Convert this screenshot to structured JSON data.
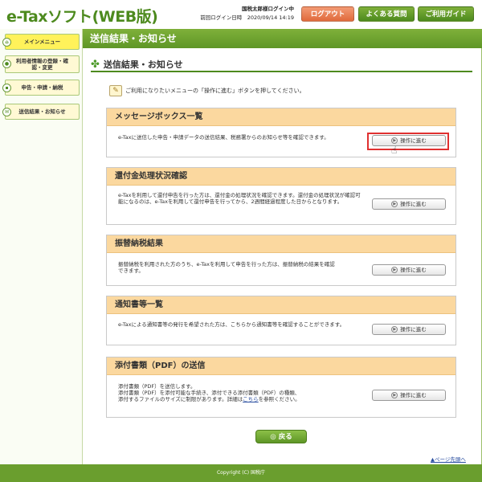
{
  "header": {
    "logo_main": "e-Taxソフト",
    "logo_paren": "(WEB版)",
    "user_status": "国税太郎様ログイン中",
    "last_login": "前回ログイン日時　2020/09/14 14:19",
    "logout": "ログアウト",
    "faq": "よくある質問",
    "guide": "ご利用ガイド"
  },
  "sidebar": {
    "items": [
      {
        "label": "メインメニュー"
      },
      {
        "label": "利用者情報の登録・確認・変更"
      },
      {
        "label": "申告・申請・納税"
      },
      {
        "label": "送信結果・お知らせ"
      }
    ]
  },
  "page": {
    "title": "送信結果・お知らせ",
    "heading": "送信結果・お知らせ",
    "notice": "ご利用になりたいメニューの「操作に進む」ボタンを押してください。",
    "back": "戻る",
    "top_link": "ページ先頭へ"
  },
  "sections": [
    {
      "title": "メッセージボックス一覧",
      "text": "e-Taxに送信した申告・申請データの送信結果、税務署からのお知らせ等を確認できます。",
      "button": "操作に進む"
    },
    {
      "title": "還付金処理状況確認",
      "text": "e-Taxを利用して還付申告を行った方は、還付金の処理状況を確認できます。還付金の処理状況が確認可能になるのは、e-Taxを利用して還付申告を行ってから、2週間経過程度した日からとなります。",
      "button": "操作に進む"
    },
    {
      "title": "振替納税結果",
      "text": "振替納税を利用された方のうち、e-Taxを利用して申告を行った方は、振替納税の結果を確認できます。",
      "button": "操作に進む"
    },
    {
      "title": "通知書等一覧",
      "text": "e-Taxによる通知書等の発行を希望された方は、こちらから通知書等を確認することができます。",
      "button": "操作に進む"
    },
    {
      "title": "添付書類（PDF）の送信",
      "text_line1": "添付書類（PDF）を送信します。",
      "text_line2": "添付書類（PDF）を添付可能な手続き、添付できる添付書類（PDF）の種類、",
      "text_line3_a": "添付するファイルのサイズに制限があります。詳細は",
      "text_line3_link": "こちら",
      "text_line3_b": "を参照ください。",
      "button": "操作に進む"
    }
  ],
  "footer": {
    "copyright": "Copyright (C) 国税庁"
  },
  "icons": {
    "clover": "clover-icon",
    "notice": "pencil-note-icon",
    "play": "play-circle-icon",
    "cursor": "hand-pointer-icon"
  }
}
